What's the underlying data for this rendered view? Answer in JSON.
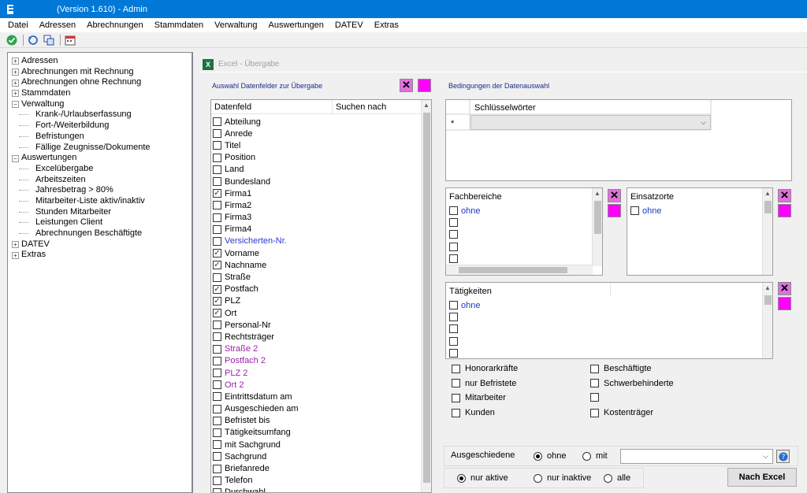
{
  "window": {
    "title": "(Version 1.610) - Admin"
  },
  "menu": [
    "Datei",
    "Adressen",
    "Abrechnungen",
    "Stammdaten",
    "Verwaltung",
    "Auswertungen",
    "DATEV",
    "Extras"
  ],
  "toolbar": {
    "icons": [
      "ok-icon",
      "refresh-icon",
      "copy-icon",
      "calendar-icon"
    ]
  },
  "tree": [
    {
      "label": "Adressen",
      "level": 0,
      "toggle": "+"
    },
    {
      "label": "Abrechnungen mit Rechnung",
      "level": 0,
      "toggle": "+"
    },
    {
      "label": "Abrechnungen ohne Rechnung",
      "level": 0,
      "toggle": "+"
    },
    {
      "label": "Stammdaten",
      "level": 0,
      "toggle": "+"
    },
    {
      "label": "Verwaltung",
      "level": 0,
      "toggle": "−"
    },
    {
      "label": "Krank-/Urlaubserfassung",
      "level": 1
    },
    {
      "label": "Fort-/Weiterbildung",
      "level": 1
    },
    {
      "label": "Befristungen",
      "level": 1
    },
    {
      "label": "Fällige Zeugnisse/Dokumente",
      "level": 1
    },
    {
      "label": "Auswertungen",
      "level": 0,
      "toggle": "−"
    },
    {
      "label": "Excelübergabe",
      "level": 1
    },
    {
      "label": "Arbeitszeiten",
      "level": 1
    },
    {
      "label": "Jahresbetrag > 80%",
      "level": 1
    },
    {
      "label": "Mitarbeiter-Liste aktiv/inaktiv",
      "level": 1
    },
    {
      "label": "Stunden Mitarbeiter",
      "level": 1
    },
    {
      "label": "Leistungen Client",
      "level": 1
    },
    {
      "label": "Abrechnungen Beschäftigte",
      "level": 1
    },
    {
      "label": "DATEV",
      "level": 0,
      "toggle": "+"
    },
    {
      "label": "Extras",
      "level": 0,
      "toggle": "+"
    }
  ],
  "subwindow": {
    "title": "Excel - Übergabe"
  },
  "fields": {
    "section_label": "Auswahl Datenfelder zur Übergabe",
    "col_field": "Datenfeld",
    "col_search": "Suchen nach",
    "rows": [
      {
        "label": "Abteilung",
        "checked": false,
        "color": "#000000"
      },
      {
        "label": "Anrede",
        "checked": false,
        "color": "#000000"
      },
      {
        "label": "Titel",
        "checked": false,
        "color": "#000000"
      },
      {
        "label": "Position",
        "checked": false,
        "color": "#000000"
      },
      {
        "label": "Land",
        "checked": false,
        "color": "#000000"
      },
      {
        "label": "Bundesland",
        "checked": false,
        "color": "#000000"
      },
      {
        "label": "Firma1",
        "checked": true,
        "color": "#000000"
      },
      {
        "label": "Firma2",
        "checked": false,
        "color": "#000000"
      },
      {
        "label": "Firma3",
        "checked": false,
        "color": "#000000"
      },
      {
        "label": "Firma4",
        "checked": false,
        "color": "#000000"
      },
      {
        "label": "Versicherten-Nr.",
        "checked": false,
        "color": "#2a3bcf"
      },
      {
        "label": "Vorname",
        "checked": true,
        "color": "#000000"
      },
      {
        "label": "Nachname",
        "checked": true,
        "color": "#000000"
      },
      {
        "label": "Straße",
        "checked": false,
        "color": "#000000"
      },
      {
        "label": "Postfach",
        "checked": true,
        "color": "#000000"
      },
      {
        "label": "PLZ",
        "checked": true,
        "color": "#000000"
      },
      {
        "label": "Ort",
        "checked": true,
        "color": "#000000"
      },
      {
        "label": "Personal-Nr",
        "checked": false,
        "color": "#000000"
      },
      {
        "label": "Rechtsträger",
        "checked": false,
        "color": "#000000"
      },
      {
        "label": "Straße 2",
        "checked": false,
        "color": "#9b1fa8"
      },
      {
        "label": "Postfach 2",
        "checked": false,
        "color": "#9b1fa8"
      },
      {
        "label": "PLZ 2",
        "checked": false,
        "color": "#9b1fa8"
      },
      {
        "label": "Ort 2",
        "checked": false,
        "color": "#9b1fa8"
      },
      {
        "label": "Eintrittsdatum am",
        "checked": false,
        "color": "#000000"
      },
      {
        "label": "Ausgeschieden am",
        "checked": false,
        "color": "#000000"
      },
      {
        "label": "Befristet bis",
        "checked": false,
        "color": "#000000"
      },
      {
        "label": "Tätigkeitsumfang",
        "checked": false,
        "color": "#000000"
      },
      {
        "label": "mit Sachgrund",
        "checked": false,
        "color": "#000000"
      },
      {
        "label": "Sachgrund",
        "checked": false,
        "color": "#000000"
      },
      {
        "label": "Briefanrede",
        "checked": false,
        "color": "#000000"
      },
      {
        "label": "Telefon",
        "checked": false,
        "color": "#000000"
      },
      {
        "label": "Durchwahl",
        "checked": false,
        "color": "#000000"
      }
    ]
  },
  "conditions": {
    "section_label": "Bedingungen der Datenauswahl",
    "keywords_header": "Schlüsselwörter",
    "new_row_marker": "*"
  },
  "fachbereiche": {
    "header": "Fachbereiche",
    "items": [
      "ohne",
      "",
      "",
      "",
      ""
    ]
  },
  "einsatzorte": {
    "header": "Einsatzorte",
    "items": [
      "ohne"
    ]
  },
  "taetigkeiten": {
    "header": "Tätigkeiten",
    "items": [
      "ohne",
      "",
      "",
      "",
      ""
    ]
  },
  "person_types": [
    {
      "label": "Honorarkräfte",
      "checked": false
    },
    {
      "label": "Beschäftigte",
      "checked": false
    },
    {
      "label": "nur Befristete",
      "checked": false
    },
    {
      "label": "Schwerbehinderte",
      "checked": false
    },
    {
      "label": "Mitarbeiter",
      "checked": false
    },
    {
      "label": "",
      "checked": false
    },
    {
      "label": "Kunden",
      "checked": false
    },
    {
      "label": "Kostenträger",
      "checked": false
    }
  ],
  "ausgeschiedene": {
    "label": "Ausgeschiedene",
    "options": [
      {
        "label": "ohne",
        "selected": true
      },
      {
        "label": "mit",
        "selected": false
      }
    ],
    "combo_value": ""
  },
  "status": {
    "options": [
      {
        "label": "nur aktive",
        "selected": true
      },
      {
        "label": "nur inaktive",
        "selected": false
      },
      {
        "label": "alle",
        "selected": false
      }
    ]
  },
  "export_button": "Nach Excel",
  "colors": {
    "titlebar": "#0078d7",
    "magenta": "#ff00ff",
    "link_blue": "#1a3bbf"
  }
}
